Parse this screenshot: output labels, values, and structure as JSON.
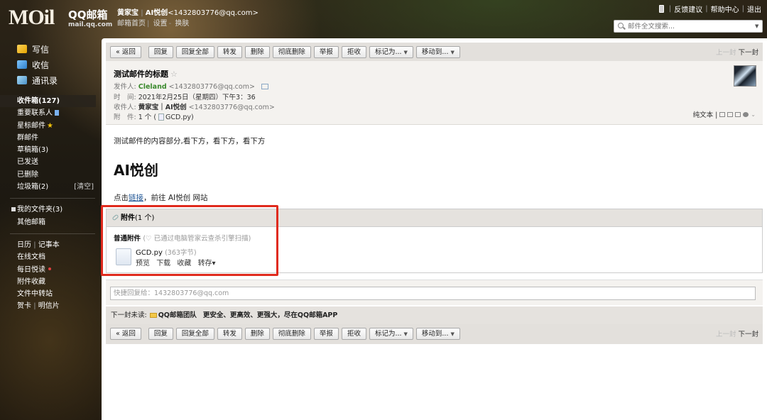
{
  "header": {
    "logo_mail": "MOil",
    "logo_qq": "QQ邮箱",
    "logo_domain": "mail.qq.com",
    "user_name": "黄家宝",
    "user_alias": "AI悦创",
    "user_email": "<1432803776@qq.com>",
    "links": [
      "邮箱首页",
      "设置",
      "换肤"
    ],
    "top_links": [
      "反馈建议",
      "帮助中心",
      "退出"
    ],
    "search_placeholder": "邮件全文搜索..."
  },
  "sidebar": {
    "main_links": [
      {
        "label": "写信",
        "icon": "write-icon"
      },
      {
        "label": "收信",
        "icon": "inbox-icon"
      },
      {
        "label": "通讯录",
        "icon": "contacts-icon"
      }
    ],
    "folders": [
      {
        "label": "收件箱(127)"
      },
      {
        "label": "重要联系人"
      },
      {
        "label": "星标邮件"
      },
      {
        "label": "群邮件"
      },
      {
        "label": "草稿箱(3)"
      },
      {
        "label": "已发送"
      },
      {
        "label": "已删除"
      },
      {
        "label": "垃圾箱(2)",
        "extra": "[清空]"
      }
    ],
    "my_folders": {
      "label": "我的文件夹(3)"
    },
    "other_mail": "其他邮箱",
    "apps": [
      {
        "label": "日历",
        "label2": "记事本"
      },
      {
        "label": "在线文档"
      },
      {
        "label": "每日悦读"
      },
      {
        "label": "附件收藏"
      },
      {
        "label": "文件中转站"
      },
      {
        "label": "贺卡",
        "label2": "明信片"
      }
    ]
  },
  "toolbar": {
    "back": "« 返回",
    "buttons": [
      "回复",
      "回复全部",
      "转发",
      "删除",
      "彻底删除",
      "举报",
      "拒收"
    ],
    "mark": "标记为...",
    "move": "移动到...",
    "prev": "上一封",
    "next": "下一封"
  },
  "mail": {
    "subject": "测试邮件的标题",
    "from_label": "发件人:",
    "from_name": "Cleland",
    "from_addr": "<1432803776@qq.com>",
    "time_label": "时　间:",
    "time_value": "2021年2月25日（星期四）下午3：36",
    "to_label": "收件人:",
    "to_name": "黄家宝｜AI悦创",
    "to_addr": "<1432803776@qq.com>",
    "att_label": "附　件:",
    "att_count": "1 个 (",
    "att_file": "GCD.py)",
    "plain_text": "纯文本 |",
    "body_line1": "测试邮件的内容部分,看下方，看下方，看下方",
    "heading": "AI悦创",
    "body_line3_pre": "点击",
    "body_line3_link": "链接",
    "body_line3_post": "，前往 AI悦创 网站"
  },
  "attachment": {
    "title": "附件",
    "count": "(1 个)",
    "type": "普通附件",
    "scan_note": "(♡ 已通过电脑管家云查杀引擎扫描)",
    "file_name": "GCD.py",
    "file_size": "(363字节)",
    "actions": [
      "预览",
      "下载",
      "收藏",
      "转存▾"
    ]
  },
  "reply": {
    "placeholder": "快捷回复给：1432803776@qq.com"
  },
  "next_mail": {
    "label": "下一封未读:",
    "sender": "QQ邮箱团队",
    "text": "更安全、更高效、更强大，尽在QQ邮箱APP"
  }
}
